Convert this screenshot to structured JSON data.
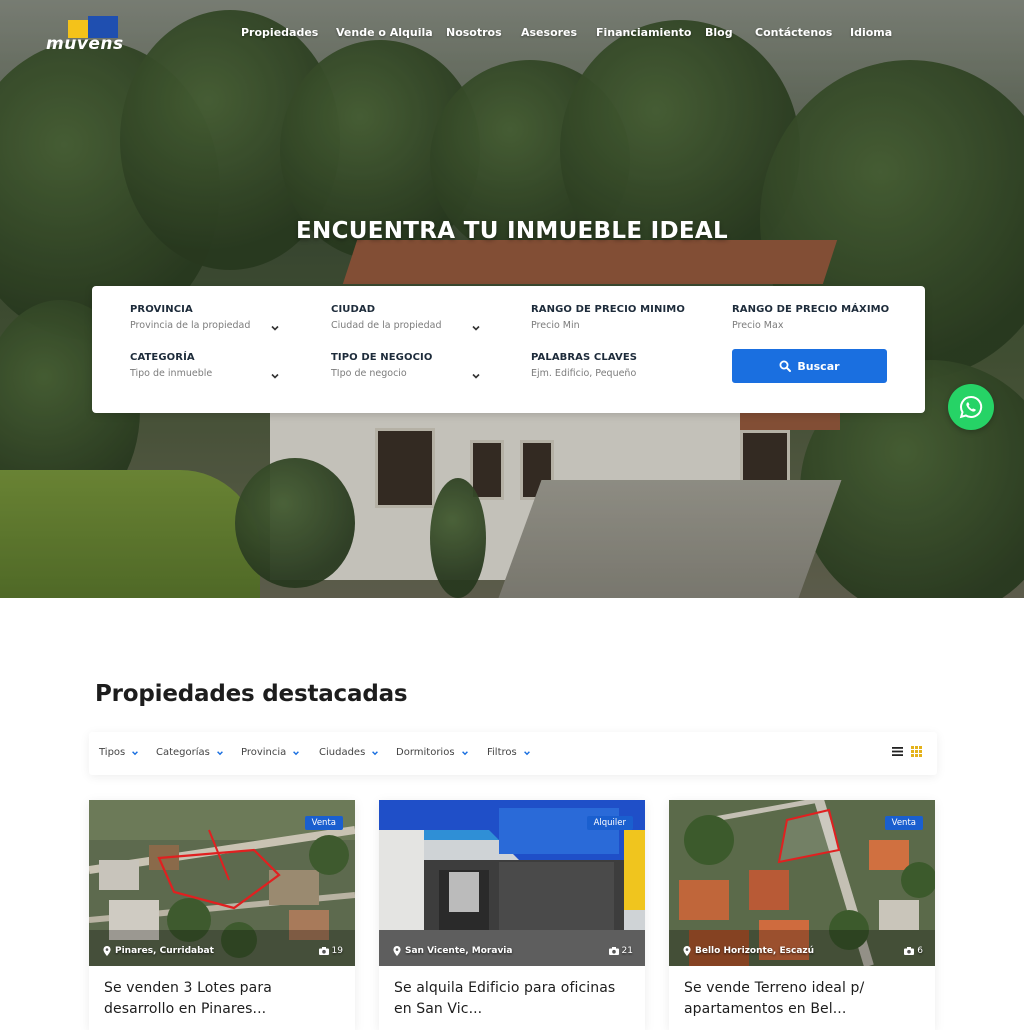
{
  "logo": {
    "text": "muvens"
  },
  "nav": {
    "items": [
      "Propiedades",
      "Vende o Alquila",
      "Nosotros",
      "Asesores",
      "Financiamiento",
      "Blog",
      "Contáctenos",
      "Idioma"
    ]
  },
  "hero": {
    "title": "ENCUENTRA TU INMUEBLE IDEAL"
  },
  "search": {
    "fields": [
      {
        "label": "PROVINCIA",
        "value": "Provincia de la propiedad"
      },
      {
        "label": "CIUDAD",
        "value": "Ciudad de la propiedad"
      },
      {
        "label": "RANGO DE PRECIO MINIMO",
        "value": "Precio Min"
      },
      {
        "label": "RANGO DE PRECIO MÁXIMO",
        "value": "Precio Max"
      },
      {
        "label": "CATEGORÍA",
        "value": "Tipo de inmueble"
      },
      {
        "label": "TIPO DE NEGOCIO",
        "value": "TIpo de negocio"
      },
      {
        "label": "PALABRAS CLAVES",
        "value": "Ejm. Edificio, Pequeño"
      }
    ],
    "button_label": "Buscar"
  },
  "featured": {
    "title": "Propiedades destacadas",
    "filters": [
      "Tipos",
      "Categorías",
      "Provincia",
      "Ciudades",
      "Dormitorios",
      "Filtros"
    ],
    "cards": [
      {
        "badge": "Venta",
        "location": "Pinares, Curridabat",
        "photos": "19",
        "title": "Se venden 3 Lotes para desarrollo en Pinares..."
      },
      {
        "badge": "Alquiler",
        "location": "San Vicente, Moravia",
        "photos": "21",
        "title": "Se alquila Edificio para oficinas en San Vic..."
      },
      {
        "badge": "Venta",
        "location": "Bello Horizonte, Escazú",
        "photos": "6",
        "title": "Se vende Terreno ideal p/ apartamentos en Bel..."
      }
    ]
  },
  "colors": {
    "primary": "#1a6fe0",
    "whatsapp": "#26d366",
    "badge": "#1a5fcf",
    "logo_yellow": "#f4c21a",
    "logo_blue": "#1f4fb0"
  },
  "icons": {
    "search": "search-icon",
    "whatsapp": "whatsapp-icon",
    "chevron": "chevron-down-icon",
    "location": "map-pin-icon",
    "camera": "camera-icon",
    "list": "list-view-icon",
    "grid": "grid-view-icon"
  }
}
